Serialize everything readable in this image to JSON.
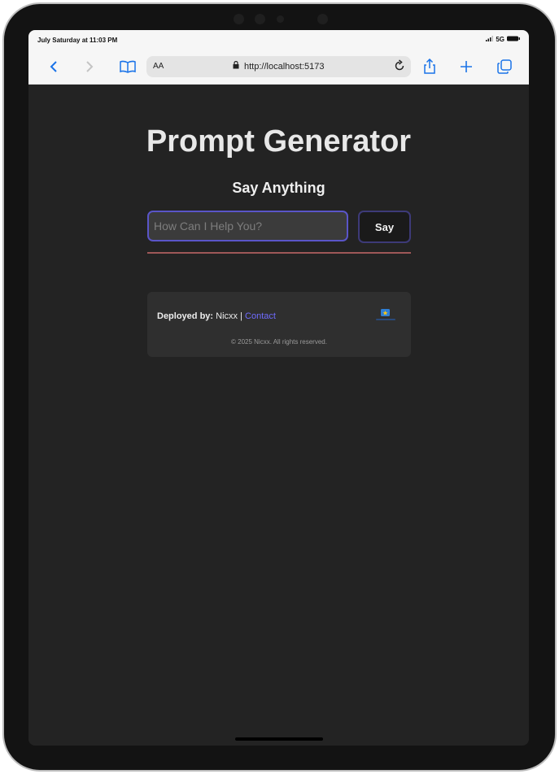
{
  "status_bar": {
    "time": "July Saturday at 11:03 PM",
    "network": "5G"
  },
  "browser": {
    "text_size_label": "AA",
    "url": "http://localhost:5173",
    "icons": [
      "back-icon",
      "forward-icon",
      "bookmarks-icon",
      "lock-icon",
      "reload-icon",
      "share-icon",
      "new-tab-icon",
      "tabs-icon"
    ]
  },
  "page": {
    "title": "Prompt Generator",
    "subtitle": "Say Anything",
    "input": {
      "placeholder": "How Can I Help You?",
      "value": ""
    },
    "say_button": "Say",
    "footer": {
      "deployed_label": "Deployed by:",
      "author": "Nicxx",
      "separator": "|",
      "contact_label": "Contact",
      "copyright": "© 2025 Nicxx. All rights reserved."
    }
  },
  "colors": {
    "page_bg": "#232323",
    "accent": "#6f6bff",
    "input_border": "#5a55c8",
    "divider": "#9e5757",
    "browser_icon": "#1a73e8"
  }
}
